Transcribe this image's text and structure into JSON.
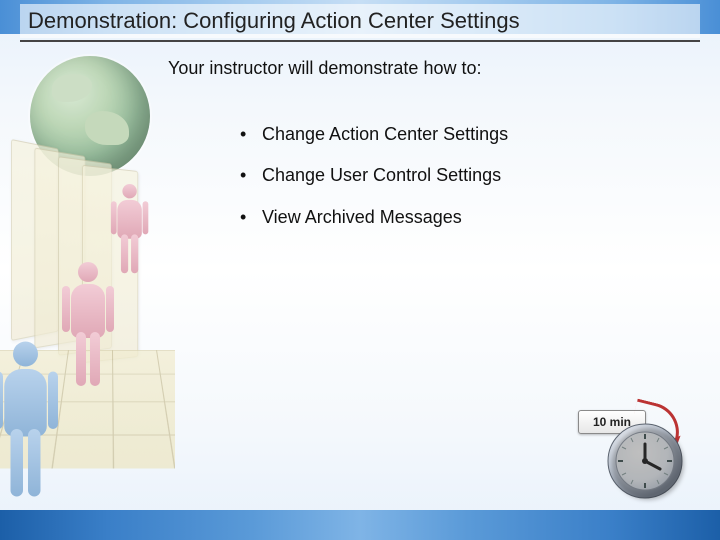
{
  "title": "Demonstration: Configuring Action Center Settings",
  "intro": "Your instructor will demonstrate how to:",
  "bullets": [
    "Change Action Center Settings",
    "Change User Control Settings",
    "View Archived Messages"
  ],
  "timer": {
    "label": "10 min"
  }
}
